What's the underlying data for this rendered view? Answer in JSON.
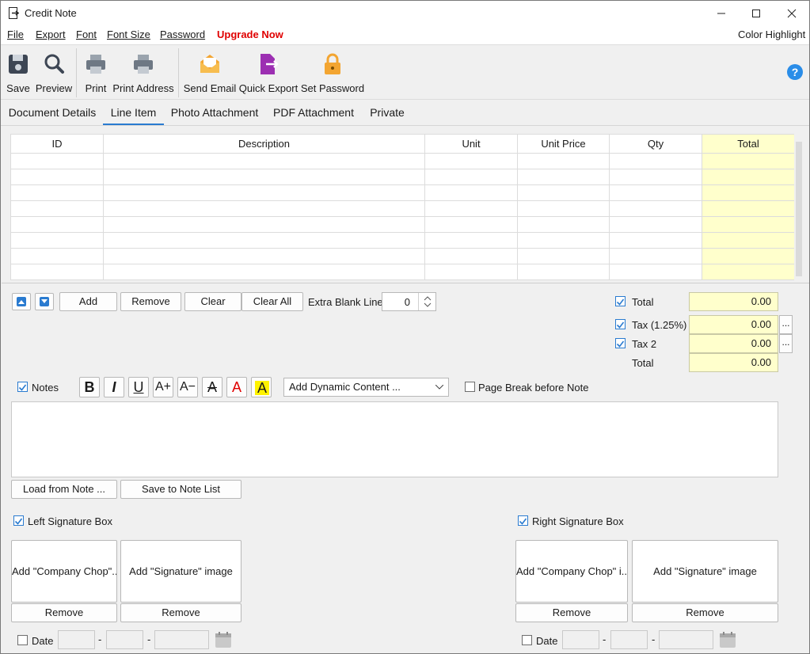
{
  "window": {
    "title": "Credit Note"
  },
  "menu": {
    "file": "File",
    "export": "Export",
    "font": "Font",
    "font_size": "Font Size",
    "password": "Password",
    "upgrade": "Upgrade Now",
    "color_highlight": "Color Highlight"
  },
  "toolbar": {
    "save": "Save",
    "preview": "Preview",
    "print": "Print",
    "print_address": "Print Address",
    "send_email": "Send Email",
    "quick_export": "Quick Export",
    "set_password": "Set Password"
  },
  "tabs": [
    "Document Details",
    "Line Item",
    "Photo Attachment",
    "PDF Attachment",
    "Private"
  ],
  "grid": {
    "columns": [
      "ID",
      "Description",
      "Unit",
      "Unit Price",
      "Qty",
      "Total"
    ],
    "rows": [
      [
        "",
        "",
        "",
        "",
        "",
        ""
      ],
      [
        "",
        "",
        "",
        "",
        "",
        ""
      ],
      [
        "",
        "",
        "",
        "",
        "",
        ""
      ],
      [
        "",
        "",
        "",
        "",
        "",
        ""
      ],
      [
        "",
        "",
        "",
        "",
        "",
        ""
      ],
      [
        "",
        "",
        "",
        "",
        "",
        ""
      ],
      [
        "",
        "",
        "",
        "",
        "",
        ""
      ],
      [
        "",
        "",
        "",
        "",
        "",
        ""
      ]
    ]
  },
  "line_actions": {
    "add": "Add",
    "remove": "Remove",
    "clear": "Clear",
    "clear_all": "Clear All",
    "extra_blank_label": "Extra Blank Line",
    "extra_blank_value": "0"
  },
  "totals": {
    "total_label": "Total",
    "total_value": "0.00",
    "tax1_label": "Tax (1.25%)",
    "tax1_value": "0.00",
    "tax2_label": "Tax 2",
    "tax2_value": "0.00",
    "grand_label": "Total",
    "grand_value": "0.00",
    "dots": "..."
  },
  "notes": {
    "label": "Notes",
    "format_buttons": [
      "B",
      "I",
      "U",
      "A+",
      "A−",
      "A",
      "A",
      "A"
    ],
    "dynamic_placeholder": "Add Dynamic Content ...",
    "page_break": "Page Break before Note",
    "load": "Load from Note ...",
    "save": "Save to Note List",
    "text": ""
  },
  "left_signature": {
    "label": "Left Signature Box",
    "chop": "Add \"Company Chop\"...",
    "signature": "Add \"Signature\" image",
    "remove": "Remove",
    "date_label": "Date",
    "dash": "-"
  },
  "right_signature": {
    "label": "Right Signature Box",
    "chop": "Add \"Company Chop\" i...",
    "signature": "Add \"Signature\" image",
    "remove": "Remove",
    "date_label": "Date",
    "dash": "-"
  },
  "colors": {
    "accent": "#2a7bd0",
    "highlight_yellow": "#ffffcc",
    "upgrade_red": "#e00000"
  }
}
